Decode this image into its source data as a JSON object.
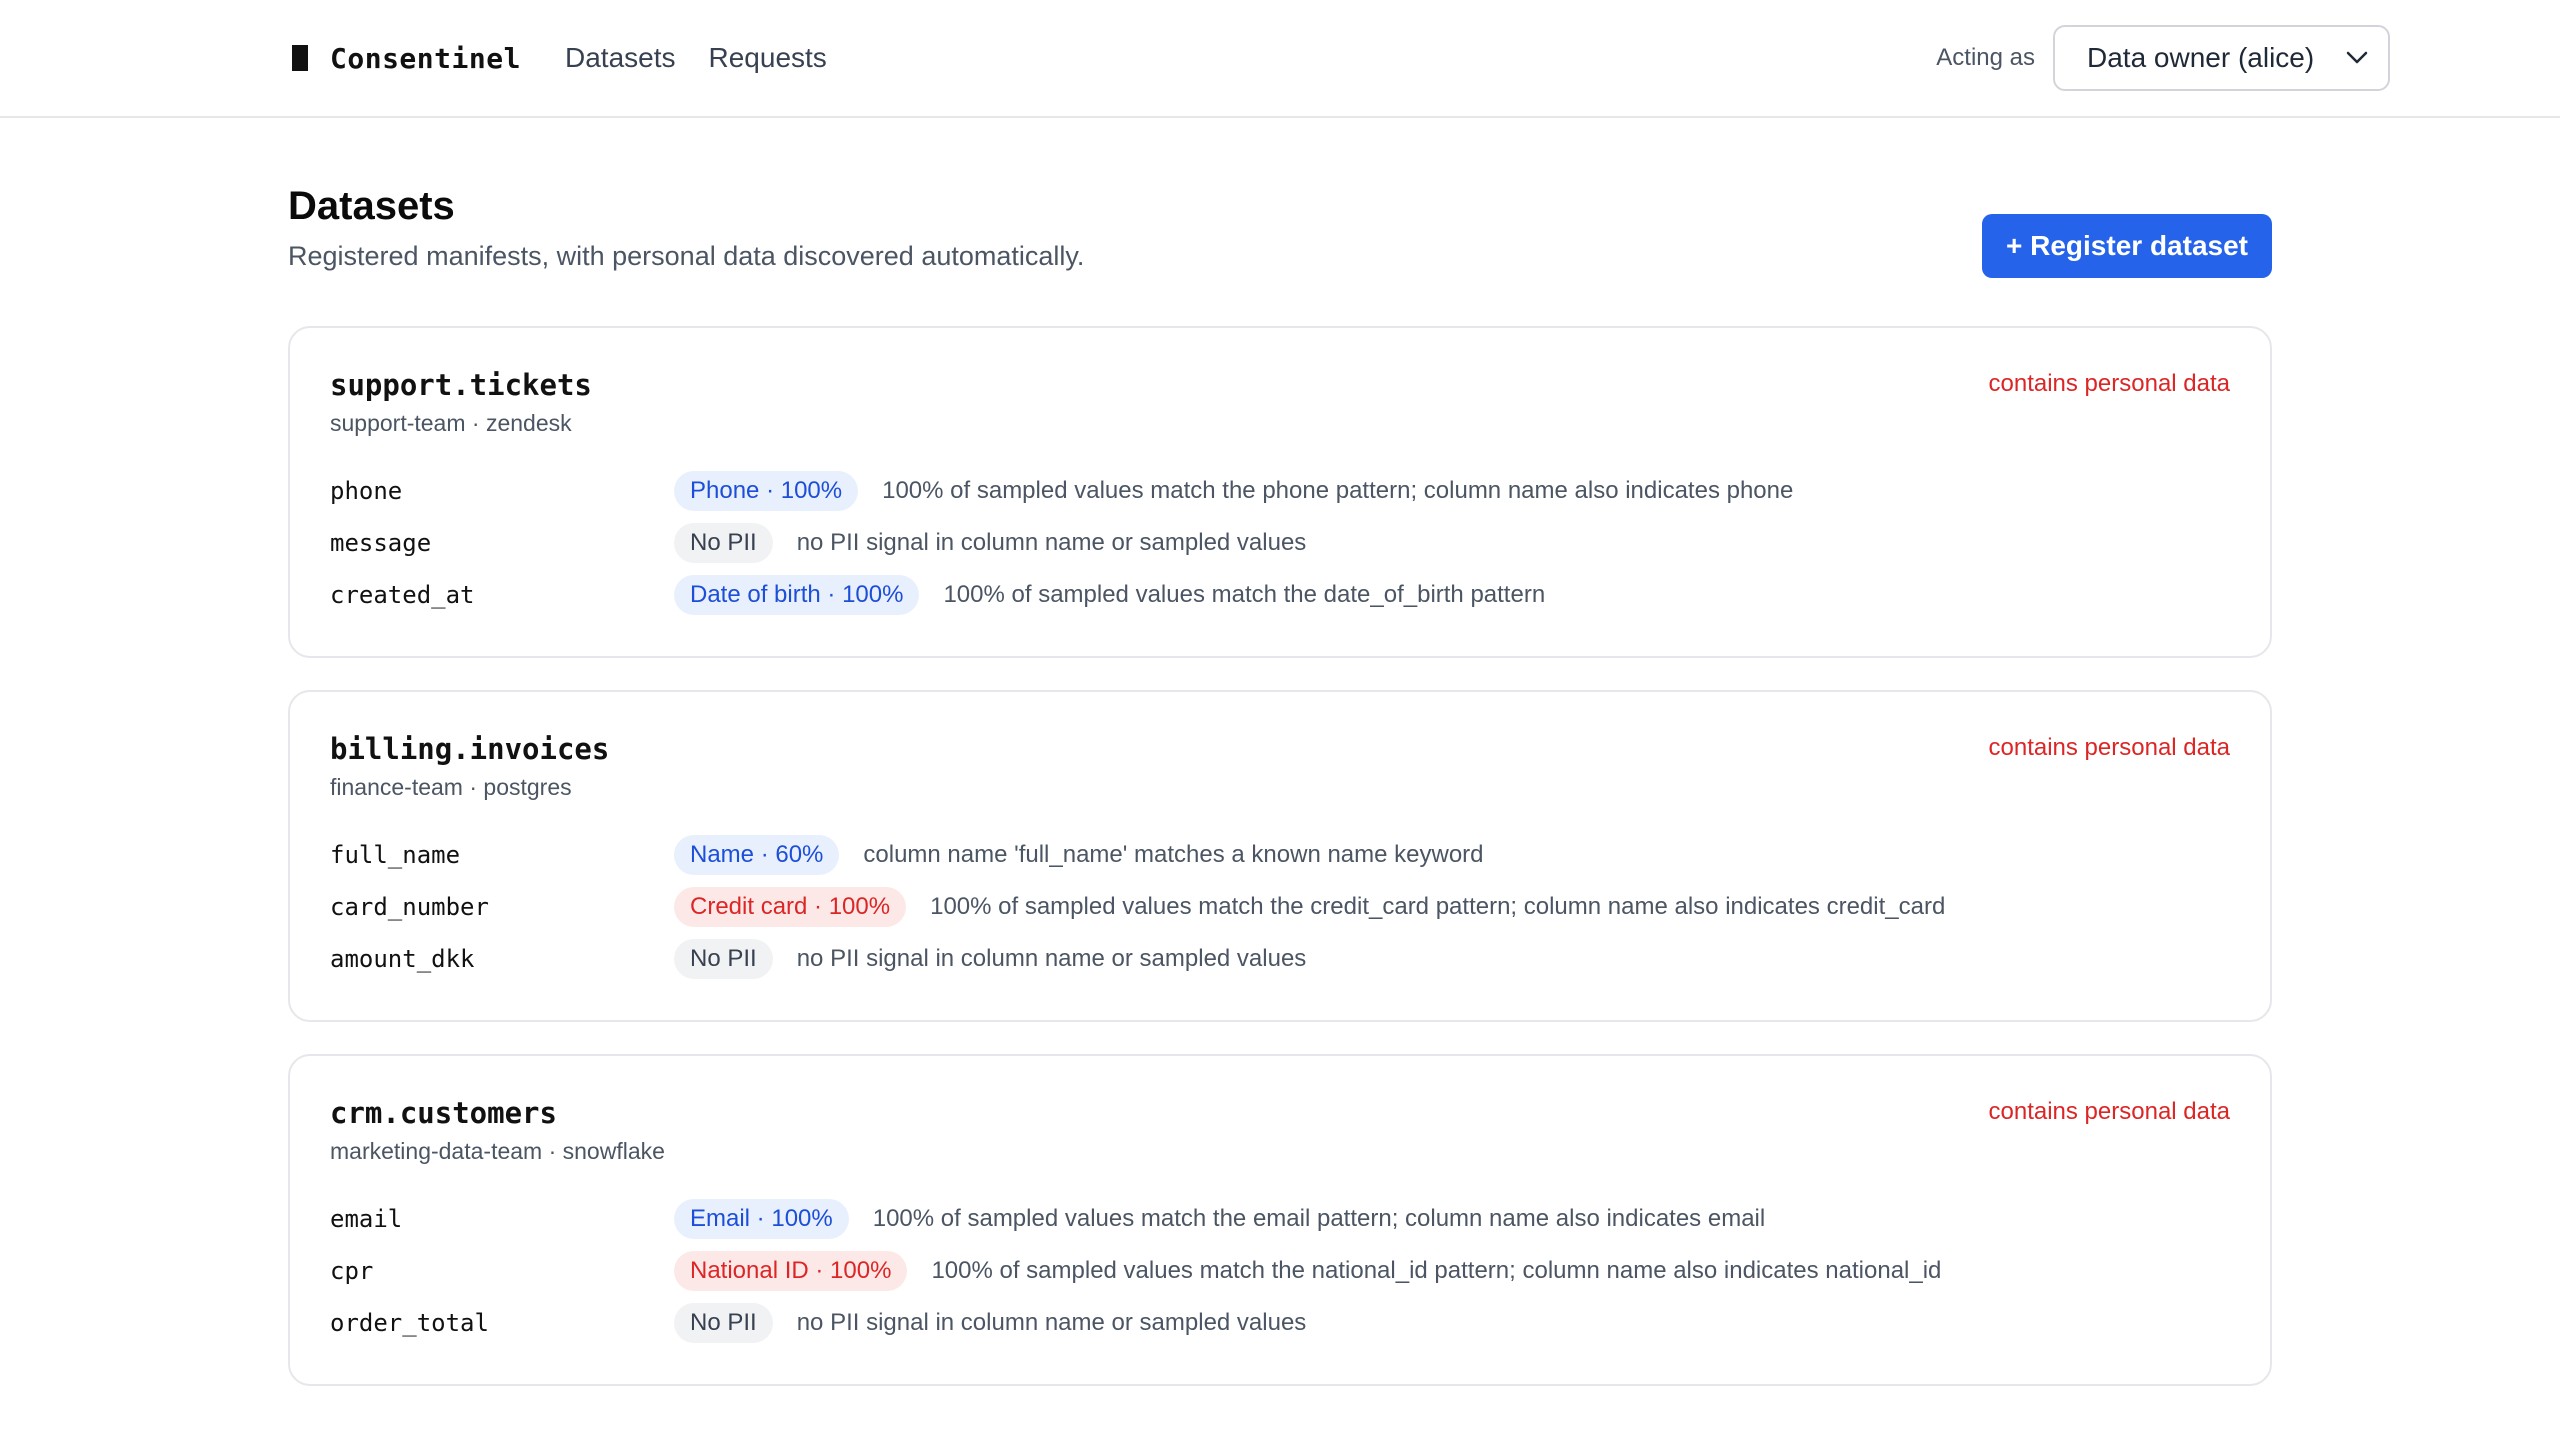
{
  "app": {
    "name": "Consentinel"
  },
  "nav": [
    "Datasets",
    "Requests"
  ],
  "acting": {
    "label": "Acting as",
    "selected": "Data owner (alice)"
  },
  "page": {
    "title": "Datasets",
    "subtitle": "Registered manifests, with personal data discovered automatically.",
    "register_label": "+ Register dataset"
  },
  "datasets": [
    {
      "name": "support.tickets",
      "owner": "support-team · zendesk",
      "flag": "contains personal data",
      "columns": [
        {
          "name": "phone",
          "chip": "Phone · 100%",
          "tone": "blue",
          "reason": "100% of sampled values match the phone pattern; column name also indicates phone"
        },
        {
          "name": "message",
          "chip": "No PII",
          "tone": "gray",
          "reason": "no PII signal in column name or sampled values"
        },
        {
          "name": "created_at",
          "chip": "Date of birth · 100%",
          "tone": "blue",
          "reason": "100% of sampled values match the date_of_birth pattern"
        }
      ]
    },
    {
      "name": "billing.invoices",
      "owner": "finance-team · postgres",
      "flag": "contains personal data",
      "columns": [
        {
          "name": "full_name",
          "chip": "Name · 60%",
          "tone": "blue",
          "reason": "column name 'full_name' matches a known name keyword"
        },
        {
          "name": "card_number",
          "chip": "Credit card · 100%",
          "tone": "red",
          "reason": "100% of sampled values match the credit_card pattern; column name also indicates credit_card"
        },
        {
          "name": "amount_dkk",
          "chip": "No PII",
          "tone": "gray",
          "reason": "no PII signal in column name or sampled values"
        }
      ]
    },
    {
      "name": "crm.customers",
      "owner": "marketing-data-team · snowflake",
      "flag": "contains personal data",
      "columns": [
        {
          "name": "email",
          "chip": "Email · 100%",
          "tone": "blue",
          "reason": "100% of sampled values match the email pattern; column name also indicates email"
        },
        {
          "name": "cpr",
          "chip": "National ID · 100%",
          "tone": "red",
          "reason": "100% of sampled values match the national_id pattern; column name also indicates national_id"
        },
        {
          "name": "order_total",
          "chip": "No PII",
          "tone": "gray",
          "reason": "no PII signal in column name or sampled values"
        }
      ]
    }
  ]
}
